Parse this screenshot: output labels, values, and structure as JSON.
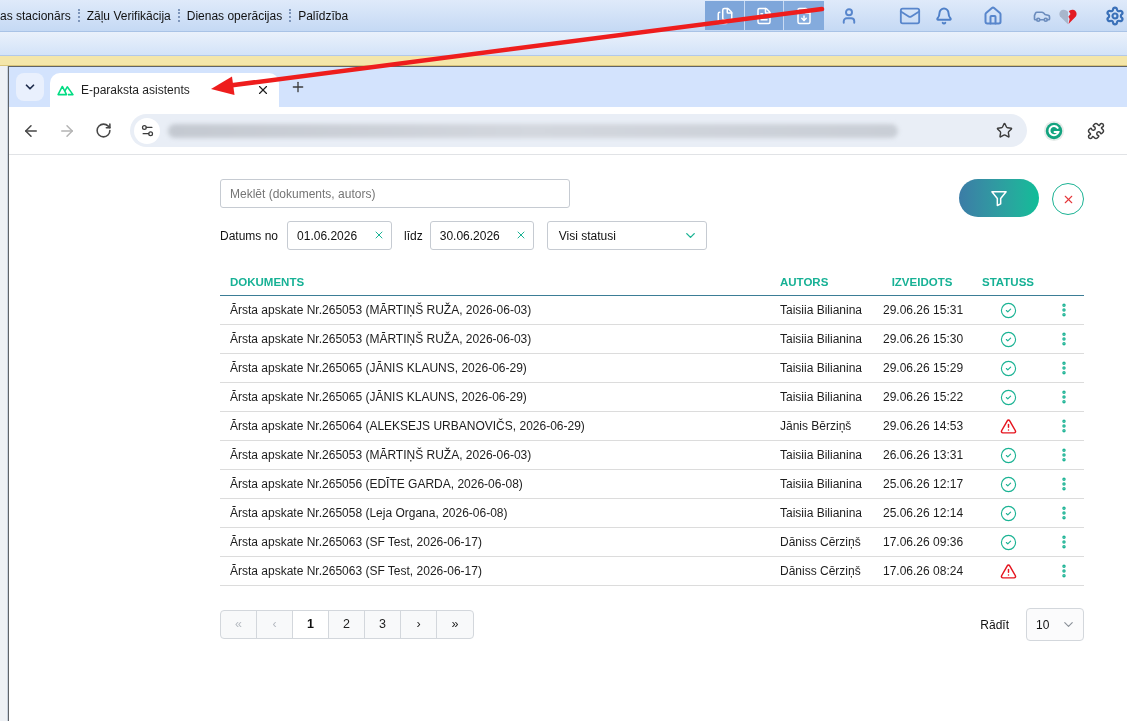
{
  "app_menu": [
    "as stacionārs",
    "Zāļu Verifikācija",
    "Dienas operācijas",
    "Palīdzība"
  ],
  "browser_tabs": [
    {
      "title": "E-paraksta asistents",
      "selected": true
    }
  ],
  "search": {
    "placeholder": "Meklēt (dokuments, autors)"
  },
  "date_range": {
    "from_label": "Datums no",
    "from": "01.06.2026",
    "to_label": "līdz",
    "to": "30.06.2026"
  },
  "status_filter": {
    "value": "Visi statusi"
  },
  "table": {
    "columns": [
      "DOKUMENTS",
      "AUTORS",
      "IZVEIDOTS",
      "STATUSS"
    ],
    "rows": [
      {
        "document": "Ārsta apskate Nr.265053 (MĀRTIŅŠ RUŽA, 2026-06-03)",
        "author": "Taisiia Bilianina",
        "created": "29.06.26 15:31",
        "warning": false
      },
      {
        "document": "Ārsta apskate Nr.265053 (MĀRTIŅŠ RUŽA, 2026-06-03)",
        "author": "Taisiia Bilianina",
        "created": "29.06.26 15:30",
        "warning": false
      },
      {
        "document": "Ārsta apskate Nr.265065 (JĀNIS KLAUNS, 2026-06-29)",
        "author": "Taisiia Bilianina",
        "created": "29.06.26 15:29",
        "warning": false
      },
      {
        "document": "Ārsta apskate Nr.265065 (JĀNIS KLAUNS, 2026-06-29)",
        "author": "Taisiia Bilianina",
        "created": "29.06.26 15:22",
        "warning": false
      },
      {
        "document": "Ārsta apskate Nr.265064 (ALEKSEJS URBANOVIČS, 2026-06-29)",
        "author": "Jānis Bērziņš",
        "created": "29.06.26 14:53",
        "warning": true
      },
      {
        "document": "Ārsta apskate Nr.265053 (MĀRTIŅŠ RUŽA, 2026-06-03)",
        "author": "Taisiia Bilianina",
        "created": "26.06.26 13:31",
        "warning": false
      },
      {
        "document": "Ārsta apskate Nr.265056 (EDĪTE GARDA, 2026-06-08)",
        "author": "Taisiia Bilianina",
        "created": "25.06.26 12:17",
        "warning": false
      },
      {
        "document": "Ārsta apskate Nr.265058 (Leja Organa, 2026-06-08)",
        "author": "Taisiia Bilianina",
        "created": "25.06.26 12:14",
        "warning": false
      },
      {
        "document": "Ārsta apskate Nr.265063 (SF Test, 2026-06-17)",
        "author": "Dāniss Cērziņš",
        "created": "17.06.26 09:36",
        "warning": false
      },
      {
        "document": "Ārsta apskate Nr.265063 (SF Test, 2026-06-17)",
        "author": "Dāniss Cērziņš",
        "created": "17.06.26 08:24",
        "warning": true
      }
    ]
  },
  "pagination": {
    "buttons": [
      {
        "label": "«",
        "selected": false,
        "disabled": true
      },
      {
        "label": "‹",
        "selected": false,
        "disabled": true
      },
      {
        "label": "1",
        "selected": true,
        "disabled": false
      },
      {
        "label": "2",
        "selected": false,
        "disabled": false
      },
      {
        "label": "3",
        "selected": false,
        "disabled": false
      },
      {
        "label": "›",
        "selected": false,
        "disabled": false
      },
      {
        "label": "»",
        "selected": false,
        "disabled": false
      }
    ]
  },
  "page_size": {
    "label": "Rādīt",
    "value": "10"
  }
}
